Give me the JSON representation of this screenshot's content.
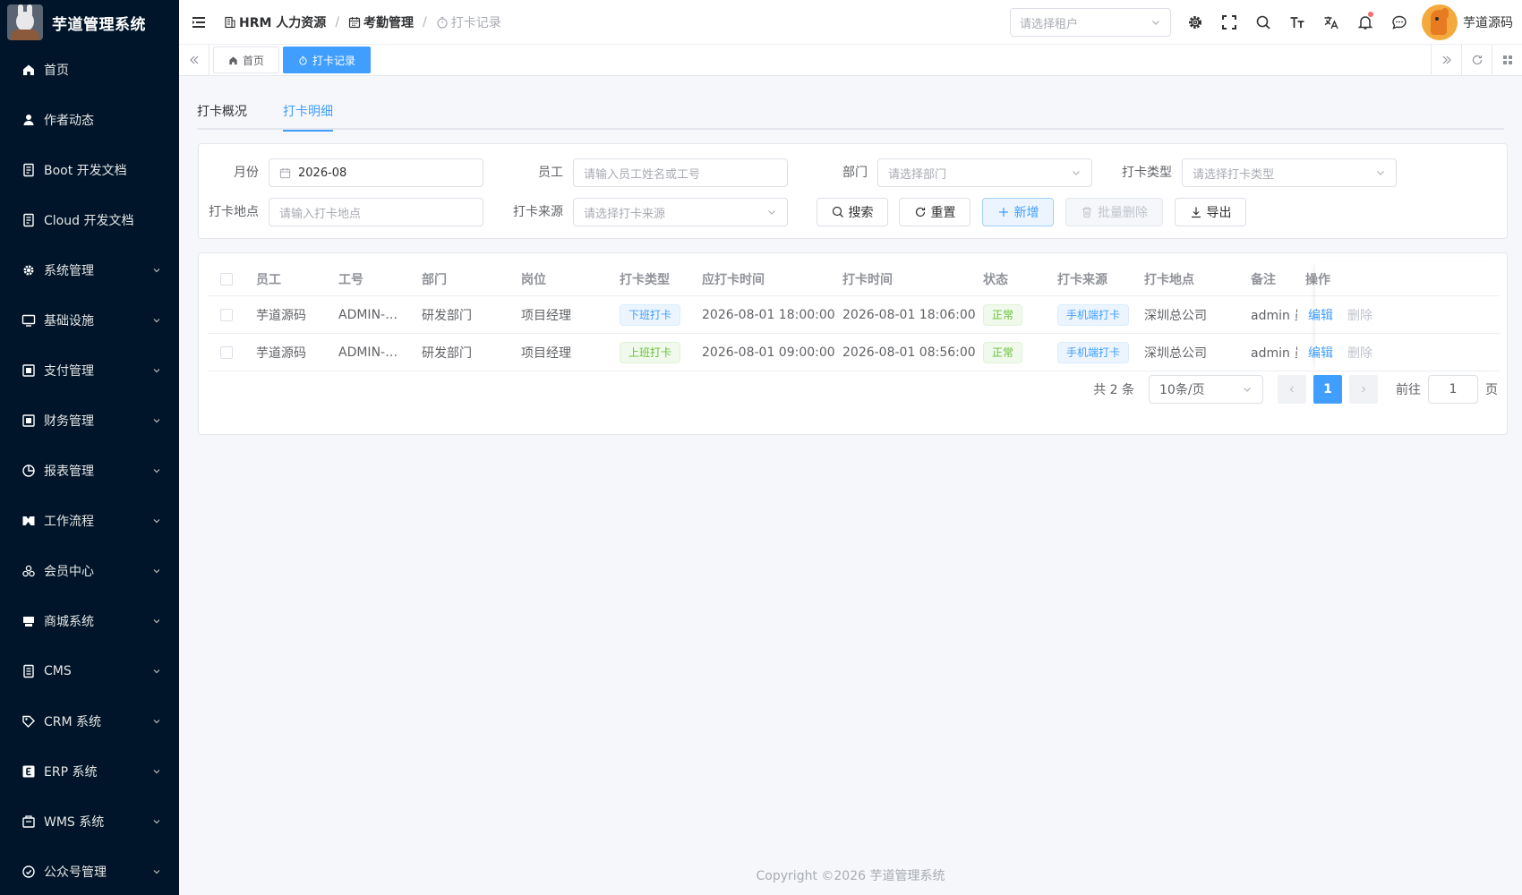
{
  "app": {
    "title": "芋道管理系统"
  },
  "sidebar": {
    "items": [
      {
        "label": "首页",
        "icon": "home-icon",
        "has_arrow": false
      },
      {
        "label": "作者动态",
        "icon": "user-icon",
        "has_arrow": false
      },
      {
        "label": "Boot 开发文档",
        "icon": "document-icon",
        "has_arrow": false
      },
      {
        "label": "Cloud 开发文档",
        "icon": "document-icon",
        "has_arrow": false
      },
      {
        "label": "系统管理",
        "icon": "gear-icon",
        "has_arrow": true
      },
      {
        "label": "基础设施",
        "icon": "monitor-icon",
        "has_arrow": true
      },
      {
        "label": "支付管理",
        "icon": "payment-icon",
        "has_arrow": true
      },
      {
        "label": "财务管理",
        "icon": "finance-icon",
        "has_arrow": true
      },
      {
        "label": "报表管理",
        "icon": "chart-icon",
        "has_arrow": true
      },
      {
        "label": "工作流程",
        "icon": "workflow-icon",
        "has_arrow": true
      },
      {
        "label": "会员中心",
        "icon": "members-icon",
        "has_arrow": true
      },
      {
        "label": "商城系统",
        "icon": "shop-icon",
        "has_arrow": true
      },
      {
        "label": "CMS",
        "icon": "cms-icon",
        "has_arrow": true
      },
      {
        "label": "CRM 系统",
        "icon": "crm-icon",
        "has_arrow": true
      },
      {
        "label": "ERP 系统",
        "icon": "erp-icon",
        "has_arrow": true
      },
      {
        "label": "WMS 系统",
        "icon": "warehouse-icon",
        "has_arrow": true
      },
      {
        "label": "公众号管理",
        "icon": "wechat-icon",
        "has_arrow": true
      }
    ]
  },
  "header": {
    "breadcrumb": [
      "HRM 人力资源",
      "考勤管理",
      "打卡记录"
    ],
    "tenant_placeholder": "请选择租户",
    "username": "芋道源码"
  },
  "tags": [
    {
      "label": "首页",
      "active": false
    },
    {
      "label": "打卡记录",
      "active": true
    }
  ],
  "subtabs": [
    {
      "label": "打卡概况",
      "active": false
    },
    {
      "label": "打卡明细",
      "active": true
    }
  ],
  "filters": {
    "month_label": "月份",
    "month_value": "2026-08",
    "employee_label": "员工",
    "employee_placeholder": "请输入员工姓名或工号",
    "dept_label": "部门",
    "dept_placeholder": "请选择部门",
    "type_label": "打卡类型",
    "type_placeholder": "请选择打卡类型",
    "location_label": "打卡地点",
    "location_placeholder": "请输入打卡地点",
    "source_label": "打卡来源",
    "source_placeholder": "请选择打卡来源",
    "search_button": "搜索",
    "reset_button": "重置",
    "add_button": "新增",
    "batch_delete_button": "批量删除",
    "export_button": "导出"
  },
  "table": {
    "columns": [
      "员工",
      "工号",
      "部门",
      "岗位",
      "打卡类型",
      "应打卡时间",
      "打卡时间",
      "状态",
      "打卡来源",
      "打卡地点",
      "备注",
      "操作"
    ],
    "rows": [
      {
        "employee": "芋道源码",
        "emp_no": "ADMIN-…",
        "dept": "研发部门",
        "position": "项目经理",
        "type": "下班打卡",
        "scheduled": "2026-08-01 18:00:00",
        "actual": "2026-08-01 18:06:00",
        "status": "正常",
        "source": "手机端打卡",
        "location": "深圳总公司",
        "remark": "admin 员",
        "edit": "编辑",
        "delete": "删除"
      },
      {
        "employee": "芋道源码",
        "emp_no": "ADMIN-…",
        "dept": "研发部门",
        "position": "项目经理",
        "type": "上班打卡",
        "scheduled": "2026-08-01 09:00:00",
        "actual": "2026-08-01 08:56:00",
        "status": "正常",
        "source": "手机端打卡",
        "location": "深圳总公司",
        "remark": "admin 员",
        "edit": "编辑",
        "delete": "删除"
      }
    ]
  },
  "pagination": {
    "total_text": "共 2 条",
    "page_size": "10条/页",
    "current_page": "1",
    "goto_label": "前往",
    "goto_value": "1",
    "page_suffix": "页"
  },
  "footer": {
    "copyright": "Copyright ©2026 芋道管理系统"
  },
  "colors": {
    "sidebar_bg": "#001529",
    "primary": "#409eff",
    "success": "#67c23a"
  }
}
